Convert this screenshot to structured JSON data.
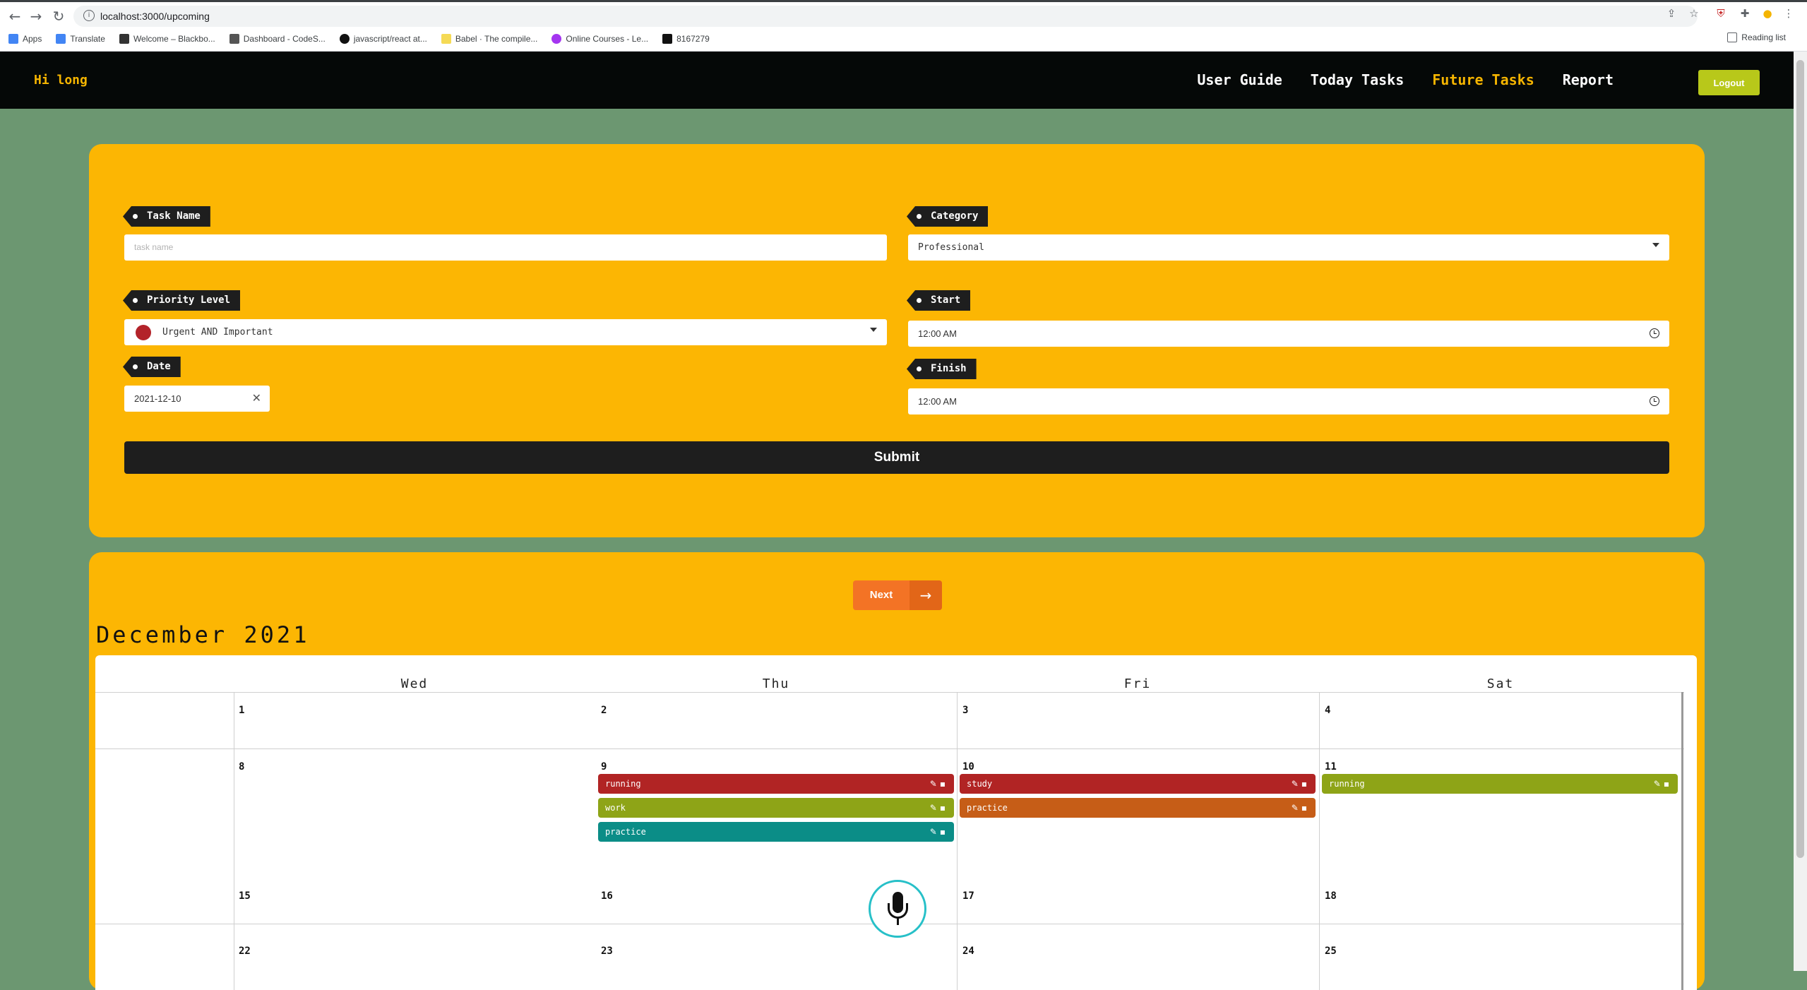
{
  "browser": {
    "url": "localhost:3000/upcoming",
    "bookmarks": [
      {
        "label": "Apps",
        "color": "#4285f4"
      },
      {
        "label": "Translate",
        "color": "#4285f4"
      },
      {
        "label": "Welcome – Blackbo...",
        "color": "#333333"
      },
      {
        "label": "Dashboard - CodeS...",
        "color": "#555555"
      },
      {
        "label": "javascript/react at...",
        "color": "#111111"
      },
      {
        "label": "Babel · The compile...",
        "color": "#f5da55"
      },
      {
        "label": "Online Courses - Le...",
        "color": "#a435f0"
      },
      {
        "label": "8167279",
        "color": "#111111"
      }
    ],
    "reading_list": "Reading list"
  },
  "navbar": {
    "greeting": "Hi long",
    "links": [
      "User Guide",
      "Today Tasks",
      "Future Tasks",
      "Report"
    ],
    "active_link": "Future Tasks",
    "logout": "Logout"
  },
  "form": {
    "task_name_label": "Task Name",
    "task_name_placeholder": "task name",
    "category_label": "Category",
    "category_value": "Professional",
    "priority_label": "Priority Level",
    "priority_value": "Urgent AND Important",
    "start_label": "Start",
    "start_value": "12:00 AM",
    "date_label": "Date",
    "date_value": "2021-12-10",
    "finish_label": "Finish",
    "finish_value": "12:00 AM",
    "submit": "Submit"
  },
  "calendar": {
    "next": "Next",
    "title": "December 2021",
    "weekdays": [
      "Wed",
      "Thu",
      "Fri",
      "Sat"
    ],
    "weeks": [
      {
        "days": [
          "1",
          "2",
          "3",
          "4"
        ]
      },
      {
        "days": [
          "8",
          "9",
          "10",
          "11"
        ]
      },
      {
        "days": [
          "15",
          "16",
          "17",
          "18"
        ]
      },
      {
        "days": [
          "22",
          "23",
          "24",
          "25"
        ]
      }
    ],
    "events": {
      "thu9": [
        {
          "label": "running",
          "color": "#b12424"
        },
        {
          "label": "work",
          "color": "#8ea417"
        },
        {
          "label": "practice",
          "color": "#0b8d87"
        }
      ],
      "fri10": [
        {
          "label": "study",
          "color": "#b12424"
        },
        {
          "label": "practice",
          "color": "#c65d17"
        }
      ],
      "sat11": [
        {
          "label": "running",
          "color": "#8ea417"
        }
      ]
    }
  }
}
